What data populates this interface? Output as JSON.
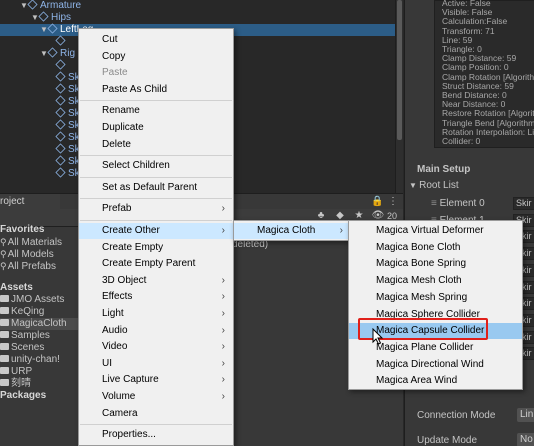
{
  "hierarchy": {
    "rows": [
      {
        "label": "Armature",
        "arrow": "▼",
        "selected": false
      },
      {
        "label": "Hips",
        "arrow": "▼",
        "selected": false
      },
      {
        "label": "LeftLeg",
        "arrow": "▼",
        "selected": true
      },
      {
        "label": "",
        "arrow": "",
        "selected": false
      },
      {
        "label": "Rig",
        "arrow": "▼",
        "selected": false
      },
      {
        "label": "",
        "arrow": "",
        "selected": false
      },
      {
        "label": "Sk",
        "arrow": "",
        "selected": false
      },
      {
        "label": "Sk",
        "arrow": "",
        "selected": false
      },
      {
        "label": "Sk",
        "arrow": "",
        "selected": false
      },
      {
        "label": "Sk",
        "arrow": "",
        "selected": false
      },
      {
        "label": "Sk",
        "arrow": "",
        "selected": false
      },
      {
        "label": "Sk",
        "arrow": "",
        "selected": false
      },
      {
        "label": "Sk",
        "arrow": "",
        "selected": false
      },
      {
        "label": "Sk",
        "arrow": "",
        "selected": false
      },
      {
        "label": "Sk",
        "arrow": "",
        "selected": false
      }
    ]
  },
  "inspector": {
    "status_lines": [
      "Active: False",
      "Visible: False",
      "Calculation:False",
      "Transform: 71",
      "Line: 59",
      "Triangle: 0",
      "Clamp Distance: 59",
      "Clamp Position: 0",
      "Clamp Rotation [Algorithm",
      "Struct Distance: 59",
      "Bend Distance: 0",
      "Near Distance: 0",
      "Restore Rotation [Algorit",
      "Triangle Bend [Algorithm_",
      "Rotation Interpolation: Lin",
      "Collider: 0"
    ],
    "main_setup": "Main Setup",
    "root_list": "Root List",
    "elements": [
      {
        "label": "Element 0",
        "value": "Skir"
      },
      {
        "label": "Element 1",
        "value": "Skir"
      },
      {
        "label": "",
        "value": "Skir"
      },
      {
        "label": "",
        "value": "Skir"
      },
      {
        "label": "",
        "value": "Skir"
      },
      {
        "label": "",
        "value": "Skir"
      },
      {
        "label": "",
        "value": "Skir"
      },
      {
        "label": "",
        "value": "Skir"
      },
      {
        "label": "",
        "value": "Skir"
      },
      {
        "label": "",
        "value": "Skir"
      }
    ],
    "connection_mode_label": "Connection Mode",
    "connection_mode_value": "Lin",
    "update_mode_label": "Update Mode",
    "update_mode_value": "No"
  },
  "project": {
    "tab_label": "roject",
    "hidden_count": "20",
    "deleted_text": "deleted)",
    "favorites_header": "Favorites",
    "favorites": [
      "All Materials",
      "All Models",
      "All Prefabs"
    ],
    "assets_header": "Assets",
    "assets": [
      "JMO Assets",
      "KeQing",
      "MagicaCloth",
      "Samples",
      "Scenes",
      "unity-chan!",
      "URP",
      "刻晴"
    ],
    "packages_header": "Packages"
  },
  "context_menu": {
    "items": [
      {
        "label": "Cut",
        "disabled": false,
        "submenu": false
      },
      {
        "label": "Copy",
        "disabled": false,
        "submenu": false
      },
      {
        "label": "Paste",
        "disabled": true,
        "submenu": false
      },
      {
        "label": "Paste As Child",
        "disabled": false,
        "submenu": false
      },
      {
        "sep": true
      },
      {
        "label": "Rename",
        "disabled": false,
        "submenu": false
      },
      {
        "label": "Duplicate",
        "disabled": false,
        "submenu": false
      },
      {
        "label": "Delete",
        "disabled": false,
        "submenu": false
      },
      {
        "sep": true
      },
      {
        "label": "Select Children",
        "disabled": false,
        "submenu": false
      },
      {
        "sep": true
      },
      {
        "label": "Set as Default Parent",
        "disabled": false,
        "submenu": false
      },
      {
        "sep": true
      },
      {
        "label": "Prefab",
        "disabled": false,
        "submenu": true
      },
      {
        "sep": true
      },
      {
        "label": "Create Other",
        "disabled": false,
        "submenu": true,
        "highlighted": true
      },
      {
        "label": "Create Empty",
        "disabled": false,
        "submenu": false
      },
      {
        "label": "Create Empty Parent",
        "disabled": false,
        "submenu": false
      },
      {
        "label": "3D Object",
        "disabled": false,
        "submenu": true
      },
      {
        "label": "Effects",
        "disabled": false,
        "submenu": true
      },
      {
        "label": "Light",
        "disabled": false,
        "submenu": true
      },
      {
        "label": "Audio",
        "disabled": false,
        "submenu": true
      },
      {
        "label": "Video",
        "disabled": false,
        "submenu": true
      },
      {
        "label": "UI",
        "disabled": false,
        "submenu": true
      },
      {
        "label": "Live Capture",
        "disabled": false,
        "submenu": true
      },
      {
        "label": "Volume",
        "disabled": false,
        "submenu": true
      },
      {
        "label": "Camera",
        "disabled": false,
        "submenu": false
      },
      {
        "sep": true
      },
      {
        "label": "Properties...",
        "disabled": false,
        "submenu": false
      }
    ]
  },
  "create_other_menu": {
    "items": [
      {
        "label": "Magica Cloth",
        "submenu": true,
        "highlighted": true
      }
    ]
  },
  "magica_menu": {
    "items": [
      {
        "label": "Magica Virtual Deformer"
      },
      {
        "label": "Magica Bone Cloth"
      },
      {
        "label": "Magica Bone Spring"
      },
      {
        "label": "Magica Mesh Cloth"
      },
      {
        "label": "Magica Mesh Spring"
      },
      {
        "label": "Magica Sphere Collider"
      },
      {
        "label": "Magica Capsule Collider",
        "highlighted": true
      },
      {
        "label": "Magica Plane Collider"
      },
      {
        "label": "Magica Directional Wind"
      },
      {
        "label": "Magica Area Wind"
      }
    ]
  },
  "colors": {
    "menu_highlight": "#cce8ff",
    "selection_highlight": "#99c9f0",
    "annotation_red": "#e0201a",
    "hierarchy_selected": "#2c5d87"
  }
}
